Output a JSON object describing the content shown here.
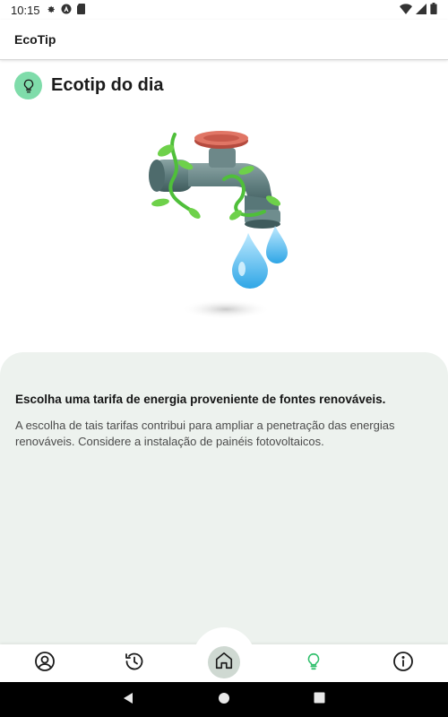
{
  "status_bar": {
    "time": "10:15"
  },
  "app_bar": {
    "title": "EcoTip"
  },
  "tip": {
    "heading": "Ecotip do dia",
    "title": "Escolha uma tarifa de energia proveniente de fontes renováveis.",
    "description": "A escolha de tais tarifas contribui para ampliar a penetração das energias renováveis. Considere a instalação de painéis fotovoltaicos."
  },
  "bottom_nav": {
    "items": [
      {
        "icon": "account-icon",
        "active": false
      },
      {
        "icon": "history-icon",
        "active": false
      },
      {
        "icon": "home-icon",
        "active": false
      },
      {
        "icon": "lightbulb-icon",
        "active": true
      },
      {
        "icon": "info-icon",
        "active": false
      }
    ]
  },
  "colors": {
    "accent_green": "#2fbf6b",
    "tip_icon_bg": "#7fdcaa",
    "card_bg": "#edf2ee",
    "home_circle_bg": "#cfd9d2"
  }
}
